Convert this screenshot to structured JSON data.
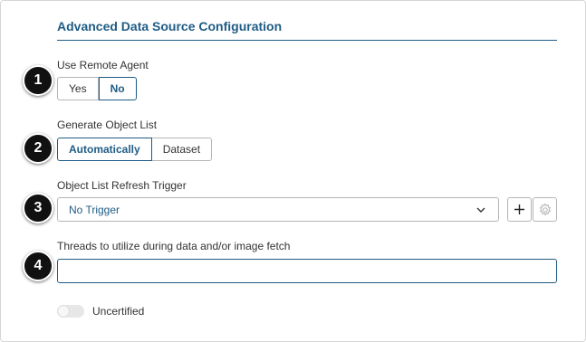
{
  "section": {
    "title": "Advanced Data Source Configuration"
  },
  "remote_agent": {
    "label": "Use Remote Agent",
    "options": [
      "Yes",
      "No"
    ],
    "selected": "No"
  },
  "object_list": {
    "label": "Generate Object List",
    "options": [
      "Automatically",
      "Dataset"
    ],
    "selected": "Automatically"
  },
  "refresh_trigger": {
    "label": "Object List Refresh Trigger",
    "value": "No Trigger",
    "icons": {
      "add": "plus-icon",
      "settings": "gear-icon",
      "dropdown": "chevron-down-icon"
    }
  },
  "threads": {
    "label": "Threads to utilize during data and/or image fetch",
    "value": ""
  },
  "certified": {
    "label": "Uncertified",
    "enabled": false
  },
  "badges": [
    "1",
    "2",
    "3",
    "4"
  ],
  "colors": {
    "accent": "#1f5c85",
    "badge": "#111111",
    "border": "#b5b5b5"
  }
}
